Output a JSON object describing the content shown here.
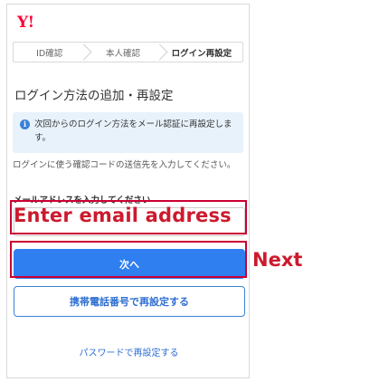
{
  "header": {
    "logo": "Y!"
  },
  "steps": [
    {
      "label": "ID確認"
    },
    {
      "label": "本人確認"
    },
    {
      "label": "ログイン再設定"
    }
  ],
  "page_title": "ログイン方法の追加・再設定",
  "info": {
    "icon": "info-icon",
    "text": "次回からのログイン方法をメール認証に再設定します。"
  },
  "description": "ログインに使う確認コードの送信先を入力してください。",
  "email_field": {
    "label": "メールアドレスを入力してください",
    "value": "",
    "placeholder": ""
  },
  "buttons": {
    "next": "次へ",
    "phone_reset": "携帯電話番号で再設定する"
  },
  "links": {
    "password_reset": "パスワードで再設定する"
  },
  "annotations": {
    "email": "Enter email address",
    "next": "Next"
  },
  "colors": {
    "brand_red": "#ff0033",
    "primary_blue": "#2f7ff0",
    "annotation_red": "#cc0033",
    "info_bg": "#e8f2fb"
  }
}
